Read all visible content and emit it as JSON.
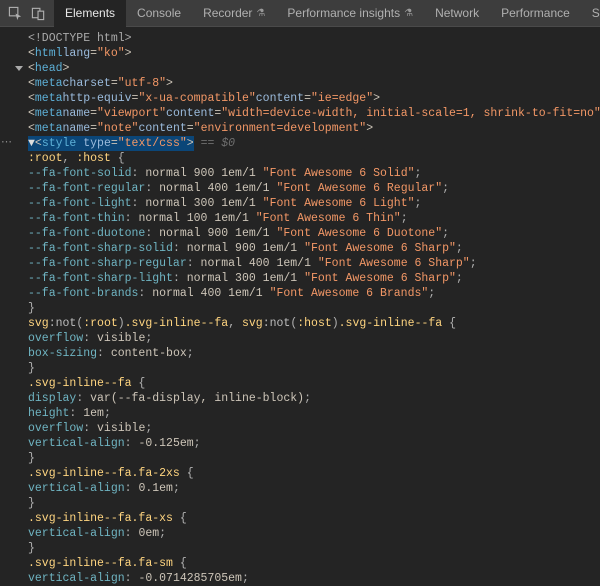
{
  "tabs": {
    "elements": "Elements",
    "console": "Console",
    "recorder": "Recorder",
    "perfinsights": "Performance insights",
    "network": "Network",
    "performance": "Performance",
    "sources": "Source"
  },
  "code": {
    "doctype": "<!DOCTYPE html>",
    "html_open_a": "<",
    "html_tag": "html",
    "html_attr": "lang",
    "html_val": "\"ko\"",
    "head_tag": "head",
    "meta_tag": "meta",
    "meta1_attr": "charset",
    "meta1_val": "\"utf-8\"",
    "meta2_attr1": "http-equiv",
    "meta2_val1": "\"x-ua-compatible\"",
    "meta2_attr2": "content",
    "meta2_val2": "\"ie=edge\"",
    "meta3_attr1": "name",
    "meta3_val1": "\"viewport\"",
    "meta3_val2": "\"width=device-width, initial-scale=1, shrink-to-fit=no\"",
    "meta4_val1": "\"note\"",
    "meta4_val2": "\"environment=development\"",
    "style_tag": "style",
    "style_attr": "type",
    "style_val": "\"text/css\"",
    "eqsel": " == $0",
    "sel1": ":root",
    "sel2": ":host",
    "brace_o": " {",
    "brace_c": "}",
    "fa1p": "--fa-font-solid",
    "fa1v": "normal 900 1em/1 ",
    "fa1s": "\"Font Awesome 6 Solid\"",
    "fa2p": "--fa-font-regular",
    "fa2v": "normal 400 1em/1 ",
    "fa2s": "\"Font Awesome 6 Regular\"",
    "fa3p": "--fa-font-light",
    "fa3v": "normal 300 1em/1 ",
    "fa3s": "\"Font Awesome 6 Light\"",
    "fa4p": "--fa-font-thin",
    "fa4v": "normal 100 1em/1 ",
    "fa4s": "\"Font Awesome 6 Thin\"",
    "fa5p": "--fa-font-duotone",
    "fa5v": "normal 900 1em/1 ",
    "fa5s": "\"Font Awesome 6 Duotone\"",
    "fa6p": "--fa-font-sharp-solid",
    "fa6v": "normal 900 1em/1 ",
    "fa6s": "\"Font Awesome 6 Sharp\"",
    "fa7p": "--fa-font-sharp-regular",
    "fa7v": "normal 400 1em/1 ",
    "fa7s": "\"Font Awesome 6 Sharp\"",
    "fa8p": "--fa-font-sharp-light",
    "fa8v": "normal 300 1em/1 ",
    "fa8s": "\"Font Awesome 6 Sharp\"",
    "fa9p": "--fa-font-brands",
    "fa9v": "normal 400 1em/1 ",
    "fa9s": "\"Font Awesome 6 Brands\"",
    "svg_pre": "svg",
    "svg_not": ":not",
    "svg_root": ":root",
    "svg_host": ":host",
    "svg_cls": ".svg-inline--fa",
    "svg_comma": ", ",
    "ov_p": "overflow",
    "ov_v": "visible",
    "bs_p": "box-sizing",
    "bs_v": "content-box",
    "cls_svg": ".svg-inline--fa",
    "disp_p": "display",
    "disp_v": "var(--fa-display, inline-block)",
    "h_p": "height",
    "h_v": "1em",
    "va_p": "vertical-align",
    "va_v1": "-0.125em",
    "cls_2xs": ".svg-inline--fa.fa-2xs",
    "va_v2": "0.1em",
    "cls_xs": ".svg-inline--fa.fa-xs",
    "va_v3": "0em",
    "cls_sm": ".svg-inline--fa.fa-sm",
    "va_v4": "-0.0714285705em",
    "semi": ";",
    "colon": ": "
  }
}
